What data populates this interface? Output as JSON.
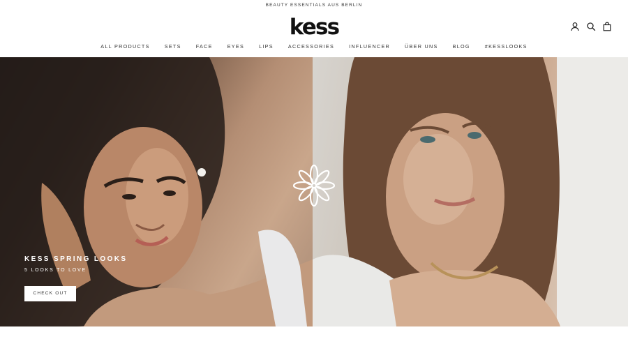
{
  "announcement": "BEAUTY ESSENTIALS AUS BERLIN",
  "logo": "kess",
  "header_icons": [
    "account-icon",
    "search-icon",
    "cart-icon"
  ],
  "nav": [
    "ALL PRODUCTS",
    "SETS",
    "FACE",
    "EYES",
    "LIPS",
    "ACCESSORIES",
    "INFLUENCER",
    "ÜBER UNS",
    "BLOG",
    "#KESSLOOKS"
  ],
  "hero": {
    "title": "KESS SPRING LOOKS",
    "subtitle": "5 LOOKS TO LOVE",
    "button": "CHECK OUT"
  },
  "colors": {
    "text": "#1c1b1b",
    "background": "#ffffff",
    "hero_text": "#ffffff"
  }
}
